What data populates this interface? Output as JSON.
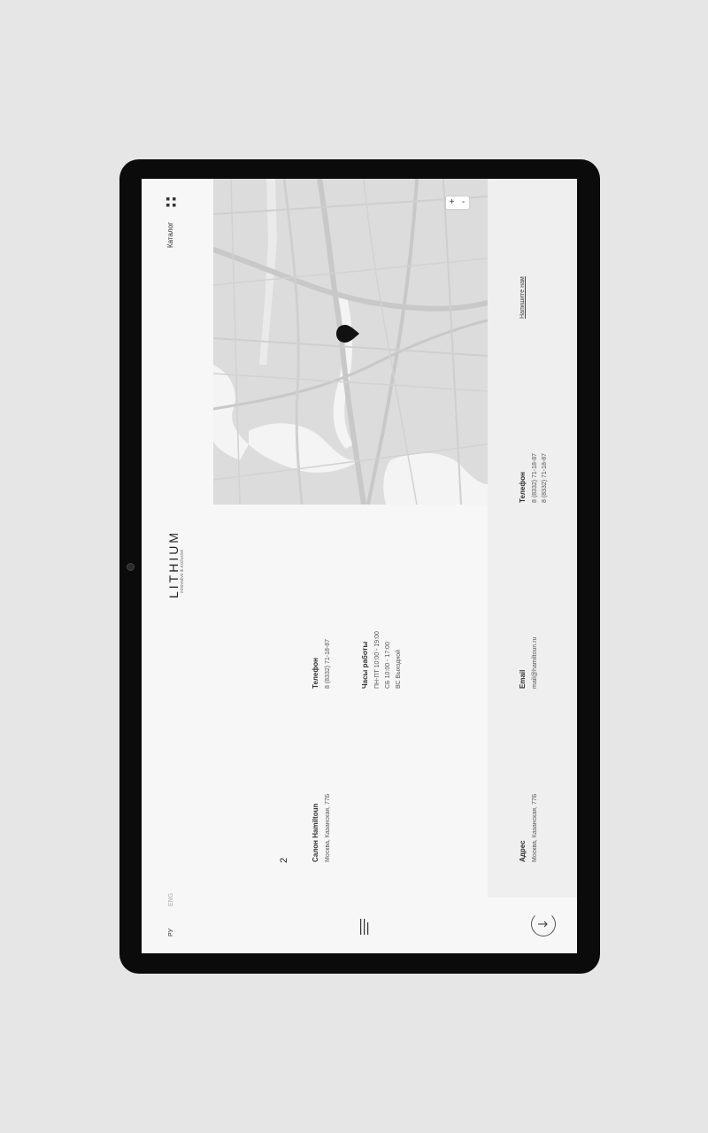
{
  "header": {
    "catalog_label": "Каталог",
    "logo": "LITHIUM",
    "tagline": "innovative & exclusive"
  },
  "lang": {
    "ru": "РУ",
    "en": "ENG"
  },
  "salon": {
    "number": "2",
    "name": "Салон Hamiltoun",
    "address": "Москва, Казанская, 77Б"
  },
  "phone_block": {
    "label": "Телефон",
    "value": "8 (8332) 71-18-87"
  },
  "hours_block": {
    "label": "Часы работы",
    "lines": [
      "ПН-ПТ 10:00 - 19:00",
      "СБ 10:00 - 17:00",
      "ВС Выходной"
    ]
  },
  "contacts": {
    "write_us": "Напишите нам",
    "phone_label": "Телефон",
    "phone_1": "8 (8332) 71-18-87",
    "phone_2": "8 (8332) 71-18-87",
    "email_label": "Email",
    "email_value": "mail@hamiltoun.ru",
    "address_label": "Адрес",
    "address_value": "Москва, Казанская, 77Б"
  },
  "map": {
    "zoom_in": "+",
    "zoom_out": "-"
  },
  "colors": {
    "device": "#0b0b0b",
    "screen": "#f7f7f7",
    "map": "#dcdcdc",
    "panel": "#efefef"
  }
}
